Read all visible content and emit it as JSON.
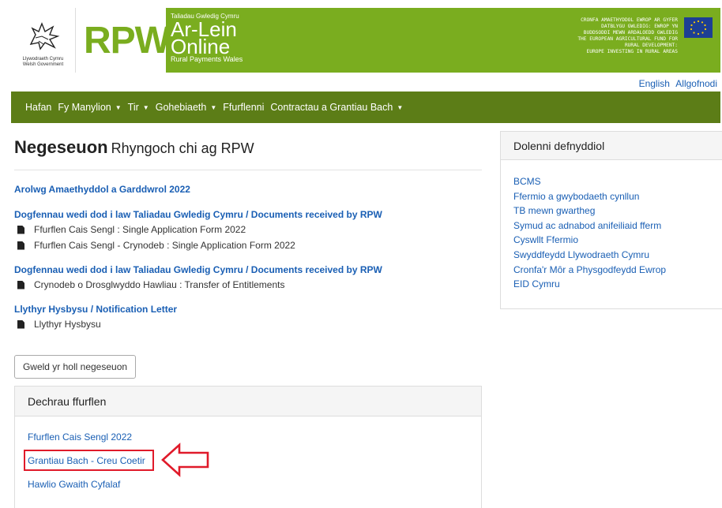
{
  "header": {
    "gov_line1": "Llywodraeth Cymru",
    "gov_line2": "Welsh Government",
    "rpw": "RPW",
    "tagline_top": "Taliadau Gwledig Cymru",
    "tagline_ar": "Ar-Lein",
    "tagline_online": "Online",
    "tagline_sub": "Rural Payments Wales",
    "eu_line1": "CRONFA AMAETHYDDOL EWROP AR GYFER",
    "eu_line2": "DATBLYGU GWLEDIG: EWROP YN",
    "eu_line3": "BUDDSODDI MEWN ARDALOEDD GWLEDIG",
    "eu_line4": "THE EUROPEAN AGRICULTURAL FUND FOR",
    "eu_line5": "RURAL DEVELOPMENT:",
    "eu_line6": "EUROPE INVESTING IN RURAL AREAS",
    "brand_color": "#7aad1f",
    "eu_flag_color": "#1d3f94"
  },
  "lang": {
    "english": "English",
    "logout": "Allgofnodi"
  },
  "nav": {
    "color": "#5c7d17",
    "items": [
      {
        "label": "Hafan"
      },
      {
        "label": "Fy Manylion",
        "dropdown": true
      },
      {
        "label": "Tir",
        "dropdown": true
      },
      {
        "label": "Gohebiaeth",
        "dropdown": true
      },
      {
        "label": "Ffurflenni"
      },
      {
        "label": "Contractau a Grantiau Bach",
        "dropdown": true
      }
    ]
  },
  "main": {
    "title": "Negeseuon",
    "subtitle": "Rhyngoch chi ag RPW",
    "groups": [
      {
        "heading": "Arolwg Amaethyddol a Garddwrol 2022",
        "docs": []
      },
      {
        "heading": "Dogfennau wedi dod i law Taliadau Gwledig Cymru / Documents received by RPW",
        "docs": [
          "Ffurflen Cais Sengl : Single Application Form 2022",
          "Ffurflen Cais Sengl - Crynodeb : Single Application Form 2022"
        ]
      },
      {
        "heading": "Dogfennau wedi dod i law Taliadau Gwledig Cymru / Documents received by RPW",
        "docs": [
          "Crynodeb o Drosglwyddo Hawliau : Transfer of Entitlements"
        ]
      },
      {
        "heading": "Llythyr Hysbysu / Notification Letter",
        "docs": [
          "Llythyr Hysbysu"
        ]
      }
    ],
    "view_all_button": "Gweld yr holl negeseuon"
  },
  "start_form": {
    "heading": "Dechrau ffurflen",
    "links": [
      "Ffurflen Cais Sengl 2022",
      "Grantiau Bach - Creu Coetir",
      "Hawlio Gwaith Cyfalaf"
    ],
    "highlight_color": "#e01a2a"
  },
  "useful_links": {
    "heading": "Dolenni defnyddiol",
    "links": [
      "BCMS",
      "Ffermio a gwybodaeth cynllun",
      "TB mewn gwartheg",
      "Symud ac adnabod anifeiliaid fferm",
      "Cyswllt Ffermio",
      "Swyddfeydd Llywodraeth Cymru",
      "Cronfa'r Môr a Physgodfeydd Ewrop",
      "EID Cymru"
    ]
  }
}
